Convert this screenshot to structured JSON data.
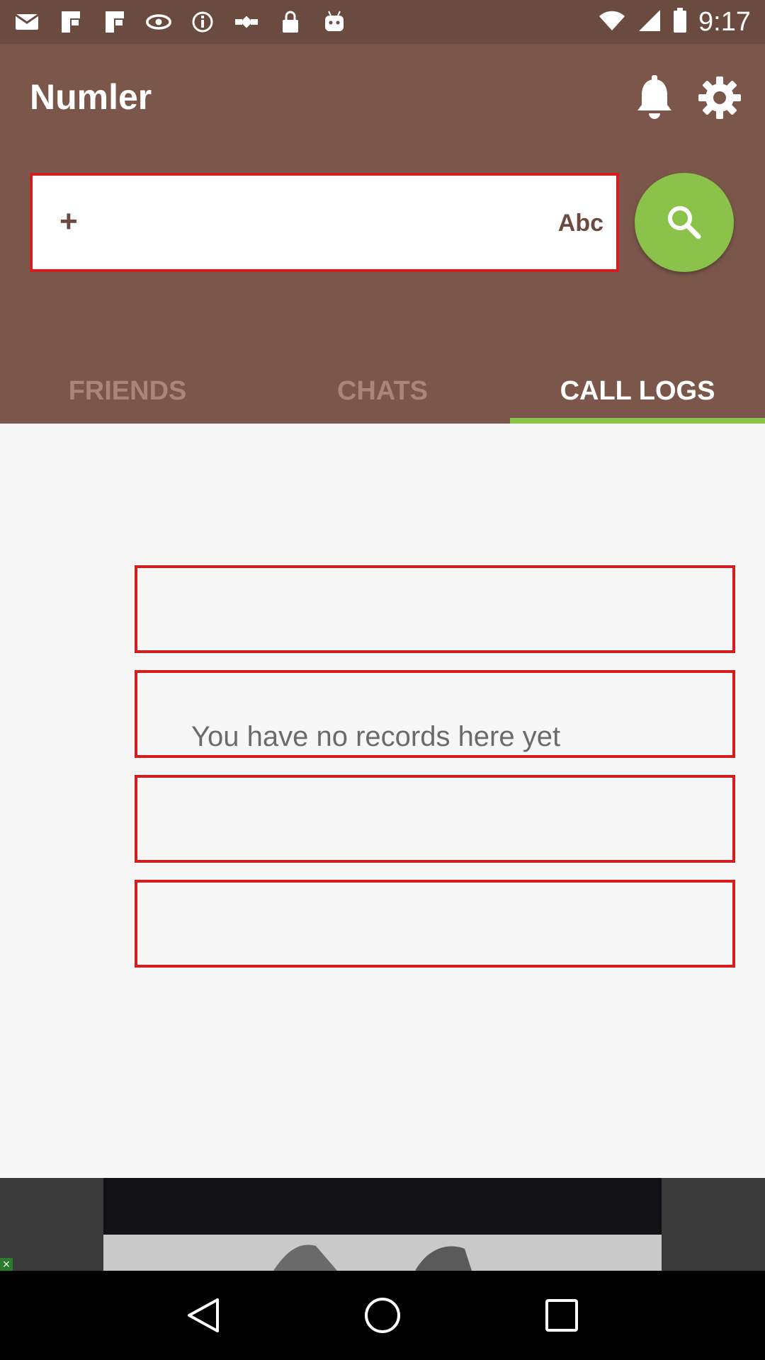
{
  "status_bar": {
    "time": "9:17",
    "icons": [
      "message-icon",
      "flipboard-icon",
      "flipboard-icon",
      "nvidia-icon",
      "info-icon",
      "fake-gps-icon",
      "lock-icon",
      "android-icon",
      "wifi-icon",
      "signal-icon",
      "battery-icon"
    ]
  },
  "header": {
    "title": "Numler",
    "notification_icon": "bell-icon",
    "settings_icon": "gear-icon"
  },
  "dialer": {
    "prefix": "+",
    "keyboard_toggle": "Abc",
    "search_icon": "search-icon",
    "accent_color": "#8bc34a"
  },
  "tabs": [
    {
      "label": "FRIENDS",
      "active": false
    },
    {
      "label": "CHATS",
      "active": false
    },
    {
      "label": "CALL LOGS",
      "active": true
    }
  ],
  "content": {
    "empty_message": "You have no records here yet"
  },
  "ad": {
    "close_icon": "close-icon"
  },
  "nav": {
    "back": "back-icon",
    "home": "home-icon",
    "recents": "recents-icon"
  },
  "colors": {
    "status_bar": "#6b4a40",
    "app_bar": "#7b574b",
    "highlight_border": "#d61c1c",
    "background": "#f7f7f7"
  }
}
